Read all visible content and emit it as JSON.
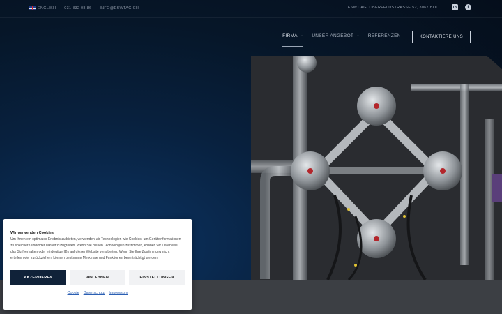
{
  "topbar": {
    "language": "ENGLISH",
    "phone": "031 832 08 86",
    "email": "INFO@ESWTAG.CH",
    "address": "ESWT AG, OBERFELDSTRASSE 52, 3067 BOLL",
    "social": [
      {
        "icon": "linkedin-icon",
        "glyph": "in"
      },
      {
        "icon": "facebook-icon",
        "glyph": "f"
      }
    ]
  },
  "nav": {
    "items": [
      {
        "label": "FIRMA",
        "has_dropdown": true,
        "active": true
      },
      {
        "label": "UNSER ANGEBOT",
        "has_dropdown": true,
        "active": false
      },
      {
        "label": "REFERENZEN",
        "has_dropdown": false,
        "active": false
      }
    ],
    "chevron": "⌄",
    "cta": "KONTAKTIERE UNS"
  },
  "cookie": {
    "title": "Wir verwenden Cookies",
    "text": "Um Ihnen ein optimales Erlebnis zu bieten, verwenden wir Technologien wie Cookies, um Geräteinformationen zu speichern und/oder darauf zuzugreifen. Wenn Sie diesen Technologien zustimmen, können wir Daten wie das Surfverhalten oder eindeutige IDs auf dieser Website verarbeiten. Wenn Sie Ihre Zustimmung nicht erteilen oder zurückziehen, können bestimmte Merkmale und Funktionen beeinträchtigt werden.",
    "accept": "AKZEPTIEREN",
    "deny": "ABLEHNEN",
    "settings": "EINSTELLUNGEN",
    "links": [
      "Cookie",
      "Datenschutz",
      "Impressum"
    ]
  },
  "colors": {
    "background": "#06111f",
    "accent_dark": "#102239",
    "bottom_band": "#3c3f44"
  }
}
